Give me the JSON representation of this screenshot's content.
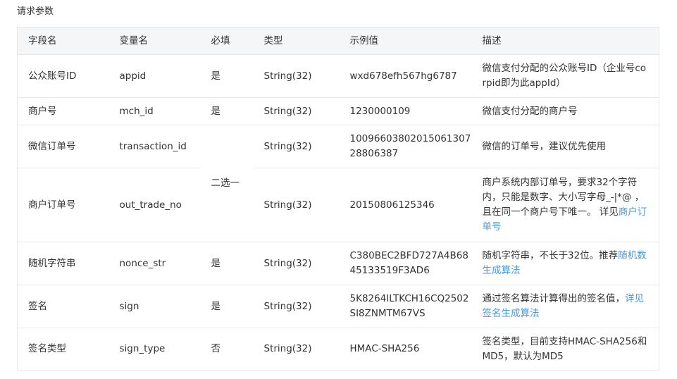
{
  "section_title": "请求参数",
  "colors": {
    "header_bg": "#f5f6f7",
    "border": "#e6e6e6",
    "text": "#333333",
    "link": "#459ae9"
  },
  "table": {
    "headers": [
      "字段名",
      "变量名",
      "必填",
      "类型",
      "示例值",
      "描述"
    ],
    "rows": [
      {
        "field": "公众账号ID",
        "variable": "appid",
        "required": "是",
        "type": "String(32)",
        "example": "wxd678efh567hg6787",
        "description": "微信支付分配的公众账号ID（企业号corpid即为此appId）",
        "link": ""
      },
      {
        "field": "商户号",
        "variable": "mch_id",
        "required": "是",
        "type": "String(32)",
        "example": "1230000109",
        "description": "微信支付分配的商户号",
        "link": ""
      },
      {
        "field": "微信订单号",
        "variable": "transaction_id",
        "required": "二选一",
        "type": "String(32)",
        "example": "1009660380201506130728806387",
        "description": "微信的订单号，建议优先使用",
        "link": ""
      },
      {
        "field": "商户订单号",
        "variable": "out_trade_no",
        "required": "",
        "type": "String(32)",
        "example": "20150806125346",
        "description": "商户系统内部订单号，要求32个字符内，只能是数字、大小写字母_-|*@ ，且在同一个商户号下唯一。 详见",
        "link": "商户订单号"
      },
      {
        "field": "随机字符串",
        "variable": "nonce_str",
        "required": "是",
        "type": "String(32)",
        "example": "C380BEC2BFD727A4B6845133519F3AD6",
        "description": "随机字符串，不长于32位。推荐",
        "link": "随机数生成算法"
      },
      {
        "field": "签名",
        "variable": "sign",
        "required": "是",
        "type": "String(32)",
        "example": "5K8264ILTKCH16CQ2502SI8ZNMTM67VS",
        "description": "通过签名算法计算得出的签名值，",
        "link": "详见签名生成算法"
      },
      {
        "field": "签名类型",
        "variable": "sign_type",
        "required": "否",
        "type": "String(32)",
        "example": "HMAC-SHA256",
        "description": "签名类型，目前支持HMAC-SHA256和MD5，默认为MD5",
        "link": ""
      }
    ]
  }
}
